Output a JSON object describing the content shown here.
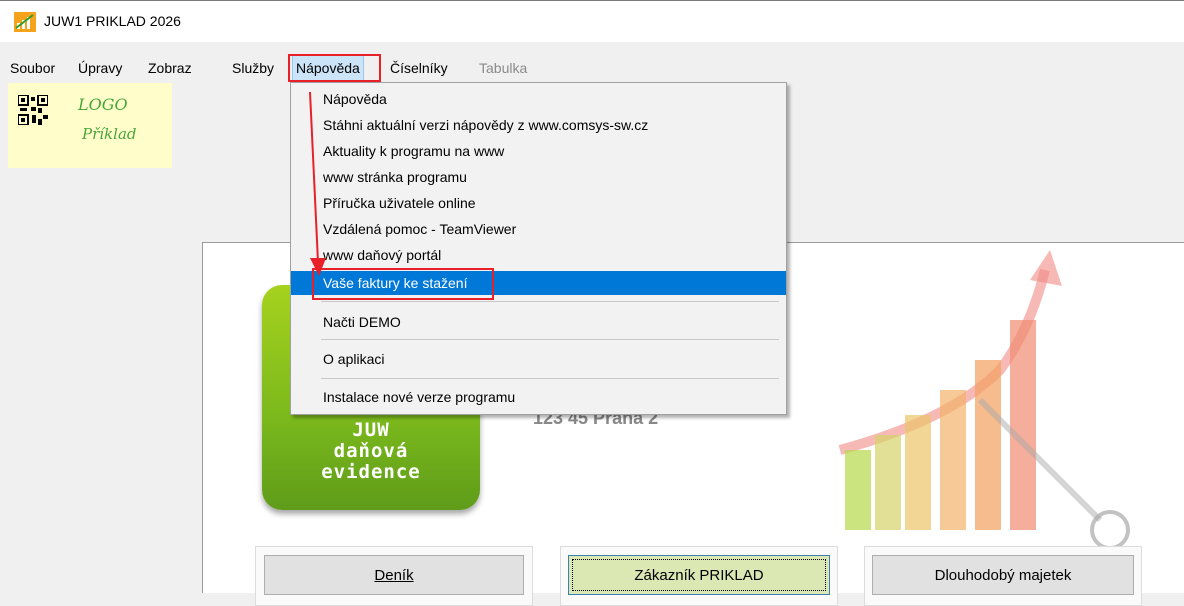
{
  "window": {
    "title": "JUW1 PRIKLAD 2026"
  },
  "menubar": {
    "items": [
      {
        "label": "Soubor"
      },
      {
        "label": "Úpravy"
      },
      {
        "label": "Zobraz"
      },
      {
        "label": "Služby"
      },
      {
        "label": "Nápověda"
      },
      {
        "label": "Číselníky"
      },
      {
        "label": "Tabulka"
      }
    ]
  },
  "logo": {
    "line1": "LOGO",
    "line2": "Příklad"
  },
  "dropdown": {
    "items": [
      {
        "label": "Nápověda"
      },
      {
        "label": "Stáhni aktuální verzi nápovědy z www.comsys-sw.cz"
      },
      {
        "label": "Aktuality k programu na www"
      },
      {
        "label": "www stránka programu"
      },
      {
        "label": "Příručka uživatele online"
      },
      {
        "label": "Vzdálená pomoc - TeamViewer"
      },
      {
        "label": "www daňový portál"
      },
      {
        "label": "Vaše faktury ke stažení"
      },
      {
        "label": "Načti DEMO"
      },
      {
        "label": "O aplikaci"
      },
      {
        "label": "Instalace nové verze programu"
      }
    ]
  },
  "product": {
    "line1": "JUW",
    "line2": "daňová",
    "line3": "evidence"
  },
  "company": {
    "address": "123 45 Praha 2"
  },
  "buttons": {
    "denik": "Deník",
    "zakaznik": "Zákazník  PRIKLAD",
    "majetek": "Dlouhodobý majetek"
  },
  "colors": {
    "selection": "#0078d7",
    "highlight": "#e8202a",
    "accent_green": "#7ab81c"
  }
}
